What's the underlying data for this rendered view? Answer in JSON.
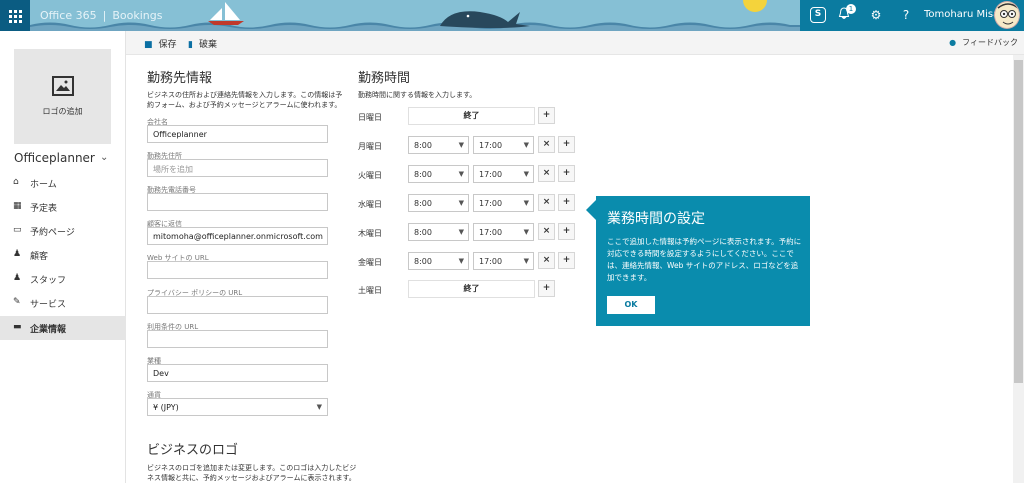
{
  "topbar": {
    "product": "Office 365",
    "separator": "|",
    "app": "Bookings",
    "skype_label": "S",
    "notification_count": "1",
    "user_name": "Tomoharu Misawa"
  },
  "commands": {
    "save": "保存",
    "discard": "破棄",
    "feedback": "フィードバック"
  },
  "sidebar": {
    "logo_label": "ロゴの追加",
    "org_name": "Officeplanner",
    "items": [
      {
        "label": "ホーム",
        "icon": "home-icon"
      },
      {
        "label": "予定表",
        "icon": "calendar-icon"
      },
      {
        "label": "予約ページ",
        "icon": "laptop-icon"
      },
      {
        "label": "顧客",
        "icon": "people-icon"
      },
      {
        "label": "スタッフ",
        "icon": "staff-icon"
      },
      {
        "label": "サービス",
        "icon": "wrench-icon"
      },
      {
        "label": "企業情報",
        "icon": "briefcase-icon"
      }
    ]
  },
  "business_info": {
    "title": "勤務先情報",
    "desc_1": "ビジネスの住所および連絡先情報を入力します。この情報は予",
    "desc_2": "約フォーム、および予約メッセージとアラームに使われます。",
    "company_label": "会社名",
    "company_value": "Officeplanner",
    "address_label": "勤務先住所",
    "address_placeholder": "場所を追加",
    "phone_label": "勤務先電話番号",
    "phone_value": "",
    "reply_label": "顧客に返信",
    "reply_value": "mitomoha@officeplanner.onmicrosoft.com",
    "website_label": "Web サイトの URL",
    "website_value": "",
    "privacy_label": "プライバシー ポリシーの URL",
    "privacy_value": "",
    "terms_label": "利用条件の URL",
    "terms_value": "",
    "industry_label": "業種",
    "industry_value": "Dev",
    "currency_label": "通貨",
    "currency_value": "¥ (JPY)"
  },
  "logo_section": {
    "title": "ビジネスのロゴ",
    "desc_1": "ビジネスのロゴを追加または変更します。このロゴは入力したビジ",
    "desc_2": "ネス情報と共に、予約メッセージおよびアラームに表示されます。"
  },
  "hours": {
    "title": "勤務時間",
    "desc": "勤務時間に関する情報を入力します。",
    "closed_label": "終了",
    "days": [
      {
        "day": "日曜日",
        "closed": true
      },
      {
        "day": "月曜日",
        "start": "8:00",
        "end": "17:00"
      },
      {
        "day": "火曜日",
        "start": "8:00",
        "end": "17:00"
      },
      {
        "day": "水曜日",
        "start": "8:00",
        "end": "17:00"
      },
      {
        "day": "木曜日",
        "start": "8:00",
        "end": "17:00"
      },
      {
        "day": "金曜日",
        "start": "8:00",
        "end": "17:00"
      },
      {
        "day": "土曜日",
        "closed": true
      }
    ]
  },
  "callout": {
    "title": "業務時間の設定",
    "body": "ここで追加した情報は予約ページに表示されます。予約に対応できる時間を設定するようにしてください。ここでは、連絡先情報、Web サイトのアドレス、ロゴなどを追加できます。",
    "ok": "OK"
  },
  "colors": {
    "accent": "#0a8cad",
    "topbar_dark": "#0b5c82"
  }
}
